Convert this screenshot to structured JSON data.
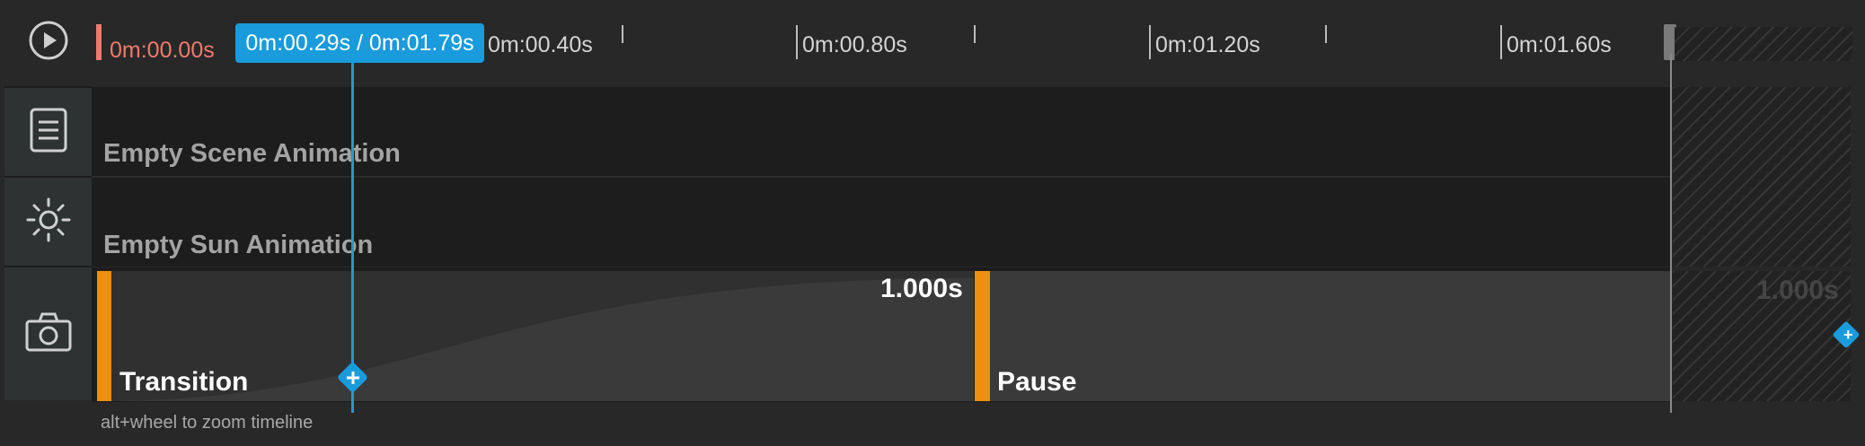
{
  "ruler": {
    "start_label": "0m:00.00s",
    "playhead_label": "0m:00.29s / 0m:01.79s",
    "ticks": [
      "0m:00.40s",
      "0m:00.80s",
      "0m:01.20s",
      "0m:01.60s"
    ]
  },
  "tracks": {
    "scene_label": "Empty Scene Animation",
    "sun_label": "Empty Sun Animation"
  },
  "camera_track": {
    "transition_label": "Transition",
    "transition_duration": "1.000s",
    "pause_label": "Pause",
    "overflow_duration": "1.000s"
  },
  "hint": "alt+wheel to zoom timeline",
  "colors": {
    "accent": "#1a9bdb",
    "start_marker": "#f07a6e",
    "clip_marker": "#ee8f10"
  },
  "icons": {
    "play": "play-icon",
    "scene": "document-icon",
    "sun": "sun-icon",
    "camera": "camera-icon"
  }
}
